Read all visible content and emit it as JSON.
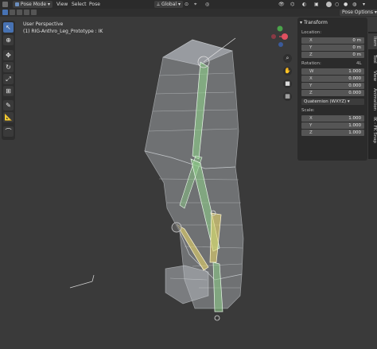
{
  "header": {
    "mode": "Pose Mode",
    "menus": [
      "View",
      "Select",
      "Pose"
    ],
    "orientation": "Global",
    "pose_options": "Pose Options"
  },
  "viewport": {
    "title": "User Perspective",
    "subtitle": "(1) RIG-Anthro_Leg_Prototype : IK"
  },
  "npanel": {
    "section": "Transform",
    "location_label": "Location:",
    "location": [
      {
        "k": "X",
        "v": "0 m"
      },
      {
        "k": "Y",
        "v": "0 m"
      },
      {
        "k": "Z",
        "v": "0 m"
      }
    ],
    "rotation_label": "Rotation:",
    "rotation_mode_badge": "4L",
    "rotation": [
      {
        "k": "W",
        "v": "1.000"
      },
      {
        "k": "X",
        "v": "0.000"
      },
      {
        "k": "Y",
        "v": "0.000"
      },
      {
        "k": "Z",
        "v": "0.000"
      }
    ],
    "rotation_mode": "Quaternion (WXYZ)",
    "scale_label": "Scale:",
    "scale": [
      {
        "k": "X",
        "v": "1.000"
      },
      {
        "k": "Y",
        "v": "1.000"
      },
      {
        "k": "Z",
        "v": "1.000"
      }
    ]
  },
  "side_tabs": [
    "Item",
    "Tool",
    "View",
    "Animation",
    "IK - FK Snap"
  ],
  "colors": {
    "active_tool": "#4772b3",
    "bone_green": "#8fd18a",
    "bone_yellow": "#e6d36a",
    "mesh": "#b9bec4"
  },
  "icons": [
    "select-box-icon",
    "cursor-icon",
    "move-icon",
    "rotate-icon",
    "scale-icon",
    "transform-icon",
    "annotate-icon",
    "measure-icon",
    "relax-icon",
    "zoom-icon",
    "hand-icon",
    "camera-icon",
    "grid-icon"
  ]
}
